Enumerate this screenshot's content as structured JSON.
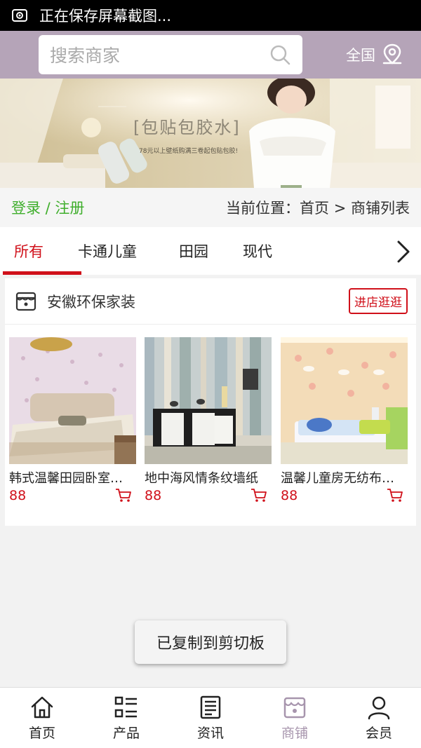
{
  "status_bar": {
    "text": "正在保存屏幕截图..."
  },
  "header": {
    "search_placeholder": "搜索商家",
    "region_label": "全国"
  },
  "banner": {
    "headline": "[包贴包胶水]",
    "promo_text": "78元以上壁纸购满三卷起包贴包胶!"
  },
  "breadcrumb": {
    "login_label": "登录 / 注册",
    "location": "当前位置：首页 > 商铺列表"
  },
  "tabs": [
    {
      "label": "所有",
      "active": true
    },
    {
      "label": "卡通儿童",
      "active": false
    },
    {
      "label": "田园",
      "active": false
    },
    {
      "label": "现代",
      "active": false
    }
  ],
  "shop": {
    "name": "安徽环保家装",
    "enter_label": "进店逛逛",
    "products": [
      {
        "name": "韩式温馨田园卧室墙纸",
        "price": "88"
      },
      {
        "name": "地中海风情条纹墙纸",
        "price": "88"
      },
      {
        "name": "温馨儿童房无纺布墙纸",
        "price": "88"
      }
    ]
  },
  "toast": {
    "text": "已复制到剪切板"
  },
  "bottom_nav": [
    {
      "label": "首页",
      "icon": "home-icon",
      "active": false
    },
    {
      "label": "产品",
      "icon": "list-icon",
      "active": false
    },
    {
      "label": "资讯",
      "icon": "news-icon",
      "active": false
    },
    {
      "label": "商铺",
      "icon": "store-icon",
      "active": true
    },
    {
      "label": "会员",
      "icon": "user-icon",
      "active": false
    }
  ],
  "colors": {
    "header_bg": "#b5a4b8",
    "accent_red": "#d0101a",
    "login_green": "#3fae2c",
    "nav_active": "#a795ad"
  }
}
